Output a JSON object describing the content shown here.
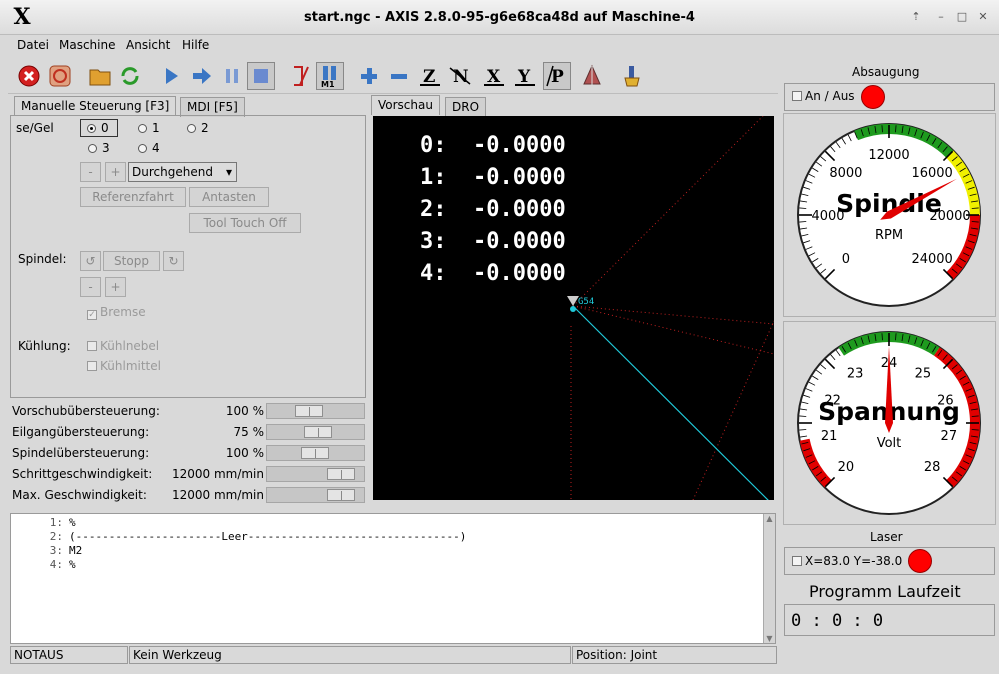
{
  "window": {
    "title": "start.ngc - AXIS 2.8.0-95-g6e68ca48d auf  Maschine-4"
  },
  "menu": [
    "Datei",
    "Maschine",
    "Ansicht",
    "Hilfe"
  ],
  "tabs_left": {
    "manual": "Manuelle Steuerung [F3]",
    "mdi": "MDI [F5]"
  },
  "tabs_view": {
    "preview": "Vorschau",
    "dro": "DRO"
  },
  "manual": {
    "axis_label": "se/Gel",
    "axes": [
      "0",
      "1",
      "2",
      "3",
      "4"
    ],
    "selected_axis": "0",
    "minus": "-",
    "plus": "+",
    "jog_mode": "Durchgehend",
    "home_button": "Referenzfahrt",
    "touch_button": "Antasten",
    "tool_touch_off": "Tool Touch Off",
    "spindle_label": "Spindel:",
    "spindle_stop": "Stopp",
    "brake": "Bremse",
    "coolant_label": "Kühlung:",
    "mist": "Kühlnebel",
    "flood": "Kühlmittel"
  },
  "overrides": [
    {
      "label": "Vorschubübersteuerung:",
      "value": "100 %",
      "position": 0.42
    },
    {
      "label": "Eilgangübersteuerung:",
      "value": "75 %",
      "position": 0.55
    },
    {
      "label": "Spindelübersteuerung:",
      "value": "100 %",
      "position": 0.5
    },
    {
      "label": "Schrittgeschwindigkeit:",
      "value": "12000 mm/min",
      "position": 0.9
    },
    {
      "label": "Max. Geschwindigkeit:",
      "value": "12000 mm/min",
      "position": 0.9
    }
  ],
  "dro": [
    {
      "axis": "0:",
      "value": "-0.0000"
    },
    {
      "axis": "1:",
      "value": "-0.0000"
    },
    {
      "axis": "2:",
      "value": "-0.0000"
    },
    {
      "axis": "3:",
      "value": "-0.0000"
    },
    {
      "axis": "4:",
      "value": "-0.0000"
    }
  ],
  "preview_origin_label": "G54",
  "gcode": [
    {
      "n": "1:",
      "text": "%"
    },
    {
      "n": "2:",
      "text": "(----------------------Leer--------------------------------)"
    },
    {
      "n": "3:",
      "text": "M2"
    },
    {
      "n": "4:",
      "text": "%"
    }
  ],
  "status": {
    "estop": "NOTAUS",
    "tool": "Kein Werkzeug",
    "position": "Position: Joint"
  },
  "absaugung": {
    "title": "Absaugung",
    "toggle": "An / Aus",
    "led_color": "#ff0000"
  },
  "spindle_gauge": {
    "title": "Spindle",
    "unit": "RPM",
    "min": 0,
    "max": 24000,
    "ticks": [
      "0",
      "4000",
      "8000",
      "12000",
      "16000",
      "20000",
      "24000"
    ],
    "value": 17500
  },
  "voltage_gauge": {
    "title": "Spannung",
    "unit": "Volt",
    "min": 20,
    "max": 28,
    "ticks": [
      "20",
      "21",
      "22",
      "23",
      "24",
      "25",
      "26",
      "27",
      "28"
    ],
    "value": 24
  },
  "laser": {
    "title": "Laser",
    "coords": "X=83.0 Y=-38.0",
    "led_color": "#ff0000"
  },
  "runtime": {
    "title": "Programm Laufzeit",
    "value": "0 : 0 : 0"
  },
  "icons": {
    "estop": "estop-icon",
    "power": "power-icon",
    "open": "folder-open-icon",
    "reload": "reload-icon",
    "run": "run-icon",
    "step": "step-icon",
    "pause": "pause-icon",
    "stop": "stop-icon",
    "skip": "block-delete-icon",
    "optional_stop": "optional-stop-icon",
    "zoom_in": "zoom-in-icon",
    "zoom_out": "zoom-out-icon",
    "view_z": "view-z-icon",
    "view_z2": "view-rotated-z-icon",
    "view_x": "view-x-icon",
    "view_y": "view-y-icon",
    "view_p": "view-perspective-icon",
    "tool": "tool-icon",
    "clear": "clear-plot-icon"
  }
}
